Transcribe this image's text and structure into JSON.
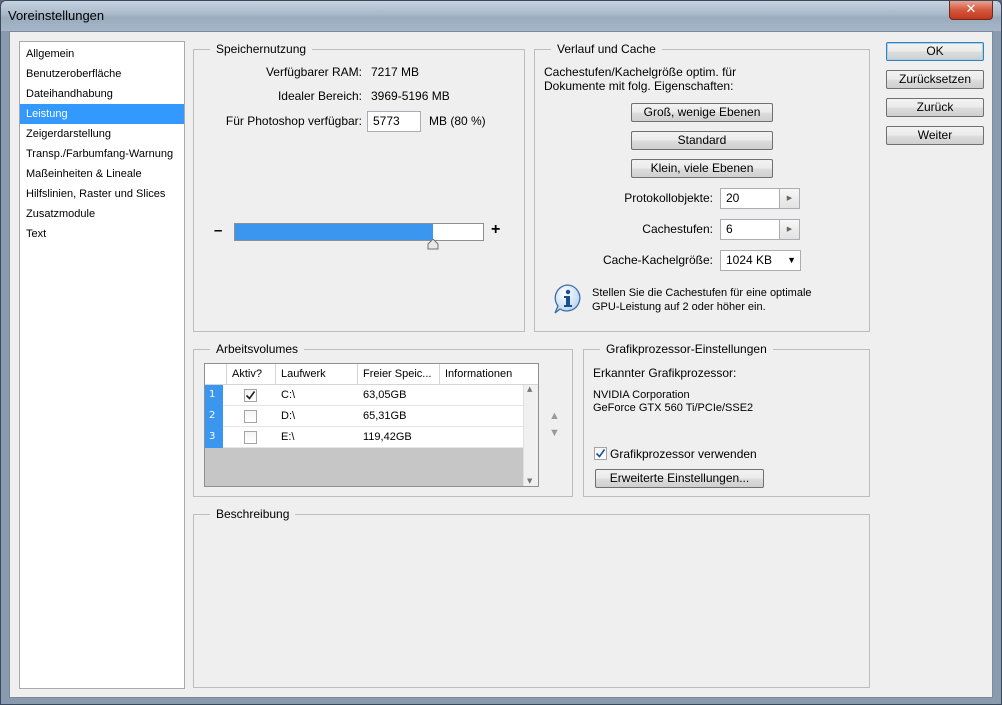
{
  "window": {
    "title": "Voreinstellungen",
    "close_glyph": "✕"
  },
  "nav": {
    "items": [
      {
        "label": "Allgemein",
        "active": false
      },
      {
        "label": "Benutzeroberfläche",
        "active": false
      },
      {
        "label": "Dateihandhabung",
        "active": false
      },
      {
        "label": "Leistung",
        "active": true
      },
      {
        "label": "Zeigerdarstellung",
        "active": false
      },
      {
        "label": "Transp./Farbumfang-Warnung",
        "active": false
      },
      {
        "label": "Maßeinheiten & Lineale",
        "active": false
      },
      {
        "label": "Hilfslinien, Raster und Slices",
        "active": false
      },
      {
        "label": "Zusatzmodule",
        "active": false
      },
      {
        "label": "Text",
        "active": false
      }
    ]
  },
  "buttons": {
    "ok": "OK",
    "reset": "Zurücksetzen",
    "back": "Zurück",
    "next": "Weiter"
  },
  "memory": {
    "title": "Speichernutzung",
    "available_label": "Verfügbarer RAM:",
    "available_value": "7217 MB",
    "ideal_label": "Idealer Bereich:",
    "ideal_value": "3969-5196 MB",
    "photoshop_label": "Für Photoshop verfügbar:",
    "photoshop_value": "5773",
    "photoshop_unit": "MB (80 %)",
    "minus": "–",
    "plus": "+",
    "slider_fraction": 0.8
  },
  "history": {
    "title": "Verlauf und Cache",
    "description": "Cachestufen/Kachelgröße optim. für",
    "description2": "Dokumente mit folg. Eigenschaften:",
    "btn_large": "Groß, wenige Ebenen",
    "btn_default": "Standard",
    "btn_small": "Klein, viele Ebenen",
    "history_states_label": "Protokollobjekte:",
    "history_states_value": "20",
    "cache_levels_label": "Cachestufen:",
    "cache_levels_value": "6",
    "tile_size_label": "Cache-Kachelgröße:",
    "tile_size_value": "1024 KB",
    "info_line1": "Stellen Sie die Cachestufen für eine optimale",
    "info_line2": "GPU-Leistung auf 2 oder höher ein."
  },
  "scratch": {
    "title": "Arbeitsvolumes",
    "columns": [
      "Aktiv?",
      "Laufwerk",
      "Freier Speic...",
      "Informationen"
    ],
    "rows": [
      {
        "num": "1",
        "active": true,
        "drive": "C:\\",
        "free": "63,05GB",
        "info": ""
      },
      {
        "num": "2",
        "active": false,
        "drive": "D:\\",
        "free": "65,31GB",
        "info": ""
      },
      {
        "num": "3",
        "active": false,
        "drive": "E:\\",
        "free": "119,42GB",
        "info": ""
      }
    ]
  },
  "gpu": {
    "title": "Grafikprozessor-Einstellungen",
    "detected_label": "Erkannter Grafikprozessor:",
    "vendor": "NVIDIA Corporation",
    "model": "GeForce GTX 560 Ti/PCIe/SSE2",
    "use_gpu_label": "Grafikprozessor verwenden",
    "use_gpu_checked": true,
    "advanced_button": "Erweiterte Einstellungen..."
  },
  "description": {
    "title": "Beschreibung"
  }
}
